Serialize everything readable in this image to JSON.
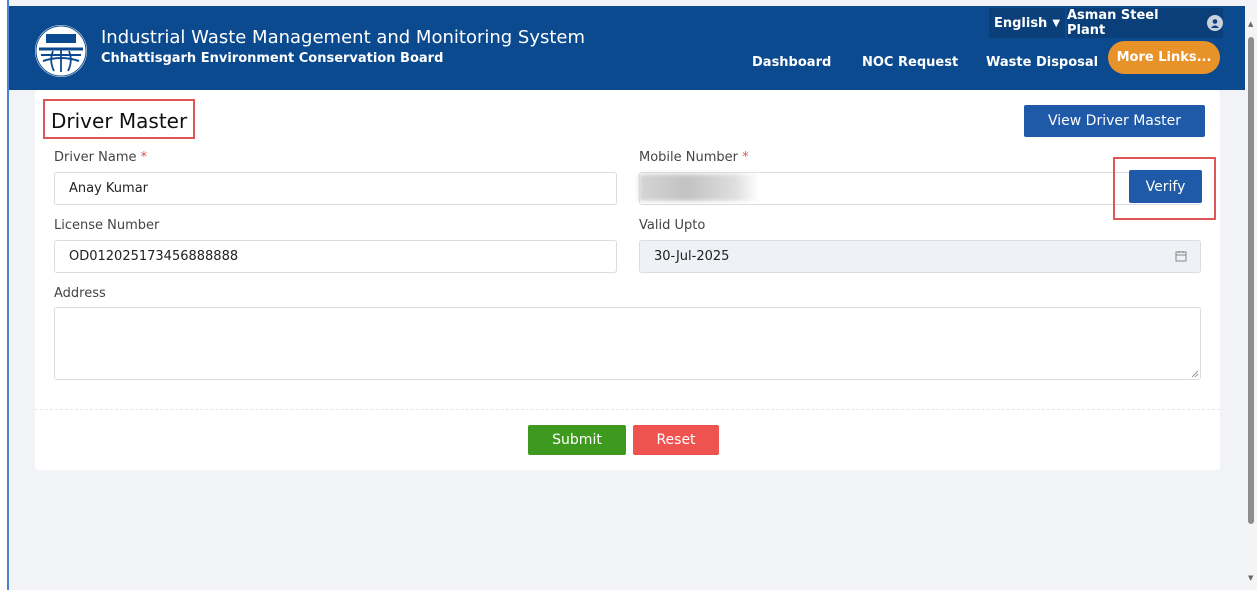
{
  "header": {
    "title": "Industrial Waste Management and Monitoring System",
    "subtitle": "Chhattisgarh Environment Conservation Board",
    "language": "English",
    "user": "Asman Steel Plant",
    "nav": {
      "dashboard": "Dashboard",
      "noc_request": "NOC Request",
      "waste_disposal": "Waste Disposal",
      "more_links": "More Links..."
    }
  },
  "page": {
    "title": "Driver Master",
    "view_button": "View Driver Master"
  },
  "form": {
    "driver_name": {
      "label": "Driver Name",
      "required_mark": "*",
      "value": "Anay Kumar"
    },
    "mobile_number": {
      "label": "Mobile Number",
      "required_mark": "*",
      "value": ""
    },
    "verify_button": "Verify",
    "license_number": {
      "label": "License Number",
      "value": "OD012025173456888888"
    },
    "valid_upto": {
      "label": "Valid Upto",
      "value": "30-Jul-2025"
    },
    "address": {
      "label": "Address",
      "value": ""
    },
    "submit_button": "Submit",
    "reset_button": "Reset"
  },
  "colors": {
    "header_bg": "#0b4a8f",
    "primary_button": "#1e5aa8",
    "more_links": "#e8932a",
    "submit": "#3e9a1f",
    "reset": "#ee5350",
    "highlight_box": "#e05555"
  }
}
